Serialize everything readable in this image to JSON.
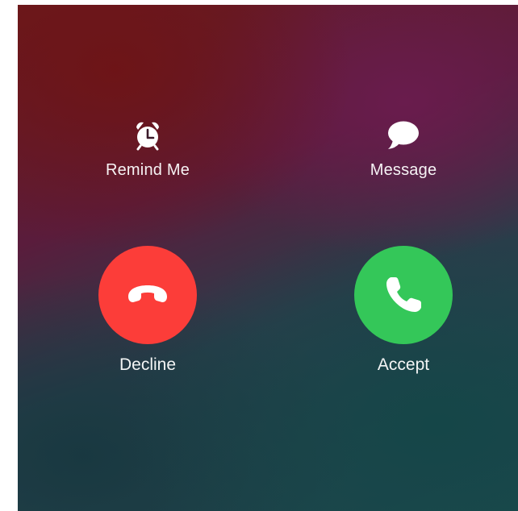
{
  "actions": {
    "remind_me": {
      "label": "Remind Me",
      "icon": "alarm-clock-icon"
    },
    "message": {
      "label": "Message",
      "icon": "speech-bubble-icon"
    },
    "decline": {
      "label": "Decline",
      "icon": "hang-up-phone-icon",
      "color": "#fc3d39"
    },
    "accept": {
      "label": "Accept",
      "icon": "phone-icon",
      "color": "#34c759"
    }
  }
}
